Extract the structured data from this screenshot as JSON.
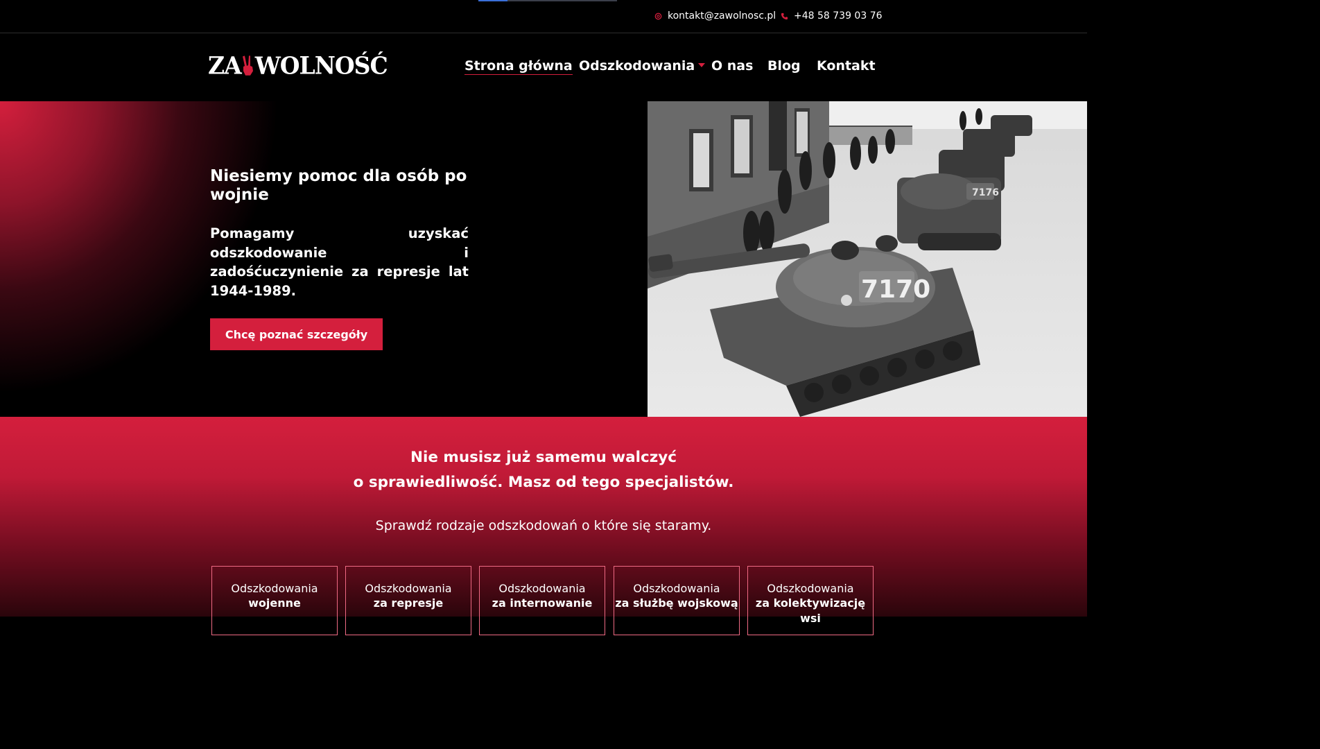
{
  "topbar": {
    "email": "kontakt@zawolnosc.pl",
    "phone": "+48 58 739 03 76"
  },
  "header": {
    "logo_left": "ZA",
    "logo_right": "WOLNOŚĆ",
    "nav": [
      {
        "label": "Strona główna",
        "active": true
      },
      {
        "label": "Odszkodowania",
        "has_dropdown": true
      },
      {
        "label": "O nas"
      },
      {
        "label": "Blog"
      },
      {
        "label": "Kontakt"
      }
    ]
  },
  "hero": {
    "title": "Niesiemy pomoc dla osób po wojnie",
    "lead": "Pomagamy uzyskać odszkodowanie i zadośćuczynienie za represje lat 1944-1989.",
    "cta": "Chcę poznać szczegóły",
    "photo_tank_number": "7170"
  },
  "services": {
    "heading_line1": "Nie musisz już samemu walczyć",
    "heading_line2": "o sprawiedliwość. Masz od tego specjalistów.",
    "subheading": "Sprawdź rodzaje odszkodowań o które się staramy.",
    "cards": [
      {
        "line1": "Odszkodowania",
        "line2": "wojenne"
      },
      {
        "line1": "Odszkodowania",
        "line2": "za represje"
      },
      {
        "line1": "Odszkodowania",
        "line2": "za internowanie"
      },
      {
        "line1": "Odszkodowania",
        "line2": "za służbę wojskową"
      },
      {
        "line1": "Odszkodowania",
        "line2": "za kolektywizację wsi"
      }
    ]
  },
  "colors": {
    "accent": "#d41f3d",
    "background": "#000000",
    "text": "#ffffff"
  }
}
